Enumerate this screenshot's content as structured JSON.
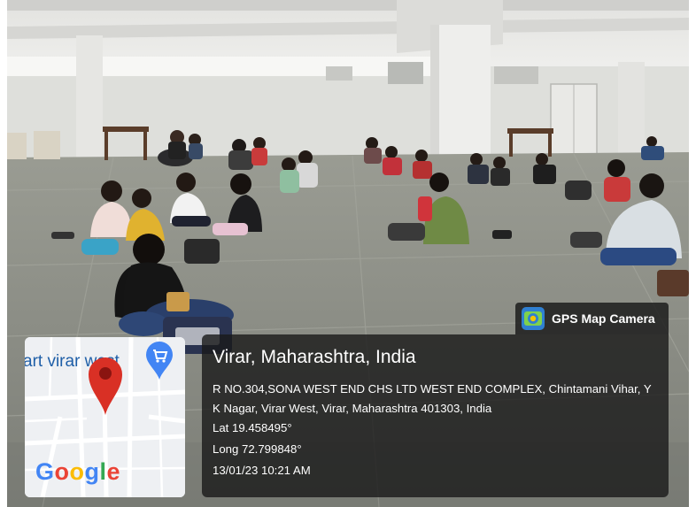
{
  "stamp": {
    "app_label": "GPS Map Camera",
    "place_title": "Virar, Maharashtra, India",
    "address": "R NO.304,SONA WEST END CHS LTD WEST END COMPLEX, Chintamani Vihar, Y K Nagar, Virar West, Virar, Maharashtra 401303, India",
    "latitude": "Lat 19.458495°",
    "longitude": "Long 72.799848°",
    "datetime": "13/01/23 10:21 AM"
  },
  "map": {
    "place_label": "art virar west",
    "google_letters": [
      "G",
      "o",
      "o",
      "g",
      "l",
      "e"
    ],
    "google_colors": [
      "#4285F4",
      "#EA4335",
      "#FBBC05",
      "#4285F4",
      "#34A853",
      "#EA4335"
    ],
    "pin_color": "#D93025",
    "shop_pin_color": "#4285F4"
  },
  "colors": {
    "floor": "#8c8f86",
    "ceiling": "#ececea",
    "panel_bg": "#191919"
  }
}
